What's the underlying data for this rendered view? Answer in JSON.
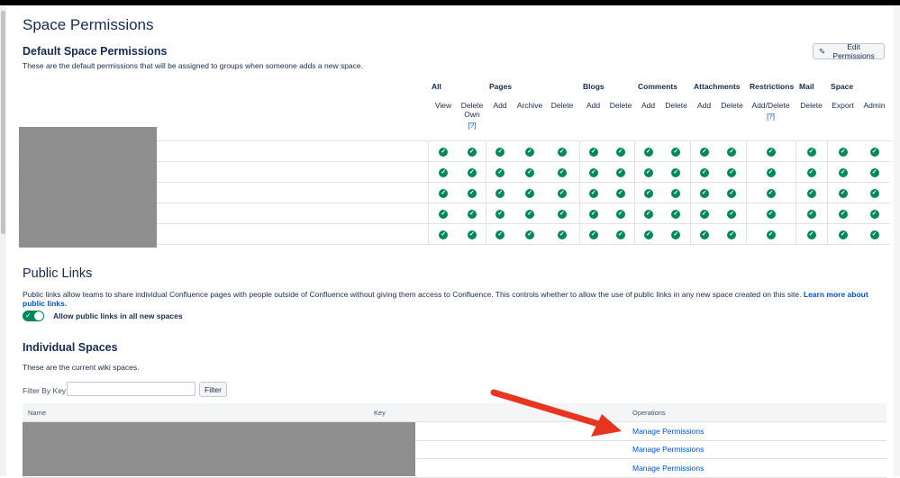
{
  "page": {
    "title": "Space Permissions"
  },
  "default_permissions": {
    "heading": "Default Space Permissions",
    "description": "These are the default permissions that will be assigned to groups when someone adds a new space.",
    "edit_label": "Edit Permissions",
    "groups": [
      {
        "label": "All",
        "span": 2,
        "cols": [
          {
            "label": "View",
            "help": ""
          },
          {
            "label": "Delete Own",
            "help": "[?]"
          }
        ]
      },
      {
        "label": "Pages",
        "span": 3,
        "cols": [
          {
            "label": "Add",
            "help": ""
          },
          {
            "label": "Archive",
            "help": ""
          },
          {
            "label": "Delete",
            "help": ""
          }
        ]
      },
      {
        "label": "Blogs",
        "span": 2,
        "cols": [
          {
            "label": "Add",
            "help": ""
          },
          {
            "label": "Delete",
            "help": ""
          }
        ]
      },
      {
        "label": "Comments",
        "span": 2,
        "cols": [
          {
            "label": "Add",
            "help": ""
          },
          {
            "label": "Delete",
            "help": ""
          }
        ]
      },
      {
        "label": "Attachments",
        "span": 2,
        "cols": [
          {
            "label": "Add",
            "help": ""
          },
          {
            "label": "Delete",
            "help": ""
          }
        ]
      },
      {
        "label": "Restrictions",
        "span": 1,
        "cols": [
          {
            "label": "Add/Delete",
            "help": "[?]"
          }
        ]
      },
      {
        "label": "Mail",
        "span": 1,
        "cols": [
          {
            "label": "Delete",
            "help": ""
          }
        ]
      },
      {
        "label": "Space",
        "span": 2,
        "cols": [
          {
            "label": "Export",
            "help": ""
          },
          {
            "label": "Admin",
            "help": ""
          }
        ]
      }
    ],
    "row_count": 5,
    "check_color": "#00875a"
  },
  "public_links": {
    "heading": "Public Links",
    "description": "Public links allow teams to share individual Confluence pages with people outside of Confluence without giving them access to Confluence. This controls whether to allow the use of public links in any new space created on this site.",
    "learn_more": "Learn more about public links.",
    "toggle_label": "Allow public links in all new spaces",
    "toggle_on": true
  },
  "individual_spaces": {
    "heading": "Individual Spaces",
    "description": "These are the current wiki spaces.",
    "filter_label": "Filter By Key:",
    "filter_value": "",
    "filter_button": "Filter",
    "columns": {
      "name": "Name",
      "key": "Key",
      "operations": "Operations"
    },
    "rows": [
      {
        "operation": "Manage Permissions"
      },
      {
        "operation": "Manage Permissions"
      },
      {
        "operation": "Manage Permissions"
      }
    ]
  },
  "colors": {
    "link": "#0052cc",
    "accent_arrow": "#e8351f",
    "redaction": "#8e8e8e"
  }
}
